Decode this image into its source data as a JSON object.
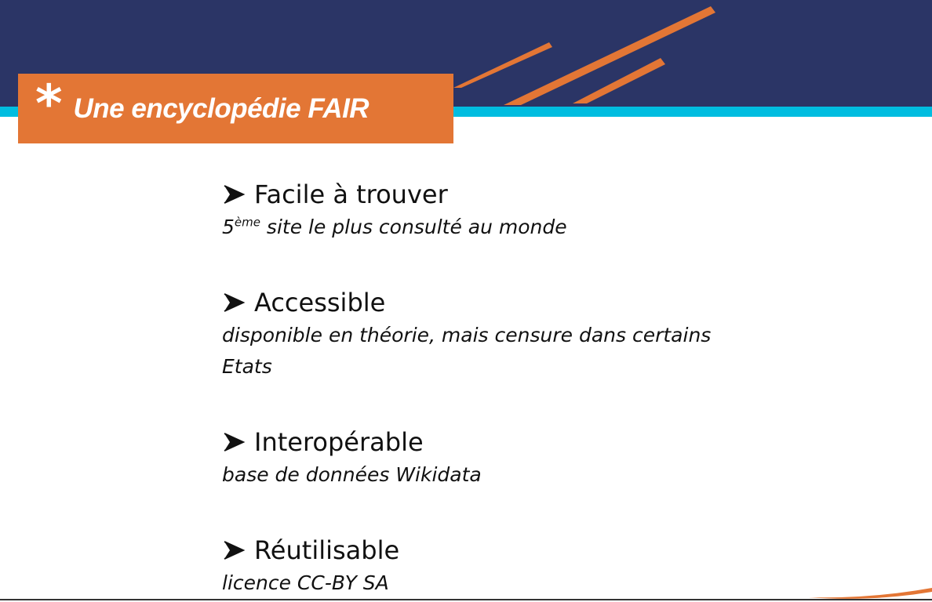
{
  "slide": {
    "title_star": "*",
    "title": "Une encyclopédie FAIR"
  },
  "items": [
    {
      "heading": "Facile à trouver",
      "desc_prefix": "5",
      "desc_sup": "ème",
      "desc_rest": " site le plus consulté au monde"
    },
    {
      "heading": "Accessible",
      "desc_line1": "disponible en théorie, mais censure dans certains",
      "desc_line2": "Etats"
    },
    {
      "heading": "Interopérable",
      "desc": "base de données Wikidata"
    },
    {
      "heading": "Réutilisable",
      "desc": "licence CC-BY SA"
    }
  ],
  "colors": {
    "navy": "#2b3566",
    "cyan": "#00bde0",
    "orange": "#e37635"
  },
  "icons": {
    "bullet": "arrow-right-icon"
  }
}
